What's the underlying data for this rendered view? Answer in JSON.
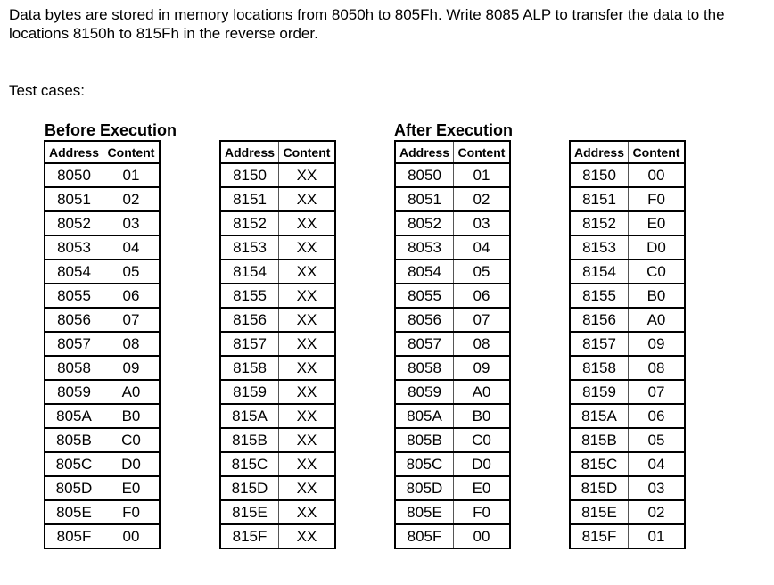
{
  "problem": {
    "text": "Data bytes are stored in memory locations from 8050h to 805Fh. Write 8085 ALP to transfer the data to the locations 8150h to 815Fh in the reverse order."
  },
  "test_cases_label": "Test cases:",
  "sections": {
    "before_title": "Before Execution",
    "after_title": "After Execution"
  },
  "columns": {
    "address": "Address",
    "content": "Content"
  },
  "tables": {
    "before_source": [
      [
        "8050",
        "01"
      ],
      [
        "8051",
        "02"
      ],
      [
        "8052",
        "03"
      ],
      [
        "8053",
        "04"
      ],
      [
        "8054",
        "05"
      ],
      [
        "8055",
        "06"
      ],
      [
        "8056",
        "07"
      ],
      [
        "8057",
        "08"
      ],
      [
        "8058",
        "09"
      ],
      [
        "8059",
        "A0"
      ],
      [
        "805A",
        "B0"
      ],
      [
        "805B",
        "C0"
      ],
      [
        "805C",
        "D0"
      ],
      [
        "805D",
        "E0"
      ],
      [
        "805E",
        "F0"
      ],
      [
        "805F",
        "00"
      ]
    ],
    "before_dest": [
      [
        "8150",
        "XX"
      ],
      [
        "8151",
        "XX"
      ],
      [
        "8152",
        "XX"
      ],
      [
        "8153",
        "XX"
      ],
      [
        "8154",
        "XX"
      ],
      [
        "8155",
        "XX"
      ],
      [
        "8156",
        "XX"
      ],
      [
        "8157",
        "XX"
      ],
      [
        "8158",
        "XX"
      ],
      [
        "8159",
        "XX"
      ],
      [
        "815A",
        "XX"
      ],
      [
        "815B",
        "XX"
      ],
      [
        "815C",
        "XX"
      ],
      [
        "815D",
        "XX"
      ],
      [
        "815E",
        "XX"
      ],
      [
        "815F",
        "XX"
      ]
    ],
    "after_source": [
      [
        "8050",
        "01"
      ],
      [
        "8051",
        "02"
      ],
      [
        "8052",
        "03"
      ],
      [
        "8053",
        "04"
      ],
      [
        "8054",
        "05"
      ],
      [
        "8055",
        "06"
      ],
      [
        "8056",
        "07"
      ],
      [
        "8057",
        "08"
      ],
      [
        "8058",
        "09"
      ],
      [
        "8059",
        "A0"
      ],
      [
        "805A",
        "B0"
      ],
      [
        "805B",
        "C0"
      ],
      [
        "805C",
        "D0"
      ],
      [
        "805D",
        "E0"
      ],
      [
        "805E",
        "F0"
      ],
      [
        "805F",
        "00"
      ]
    ],
    "after_dest": [
      [
        "8150",
        "00"
      ],
      [
        "8151",
        "F0"
      ],
      [
        "8152",
        "E0"
      ],
      [
        "8153",
        "D0"
      ],
      [
        "8154",
        "C0"
      ],
      [
        "8155",
        "B0"
      ],
      [
        "8156",
        "A0"
      ],
      [
        "8157",
        "09"
      ],
      [
        "8158",
        "08"
      ],
      [
        "8159",
        "07"
      ],
      [
        "815A",
        "06"
      ],
      [
        "815B",
        "05"
      ],
      [
        "815C",
        "04"
      ],
      [
        "815D",
        "03"
      ],
      [
        "815E",
        "02"
      ],
      [
        "815F",
        "01"
      ]
    ]
  }
}
